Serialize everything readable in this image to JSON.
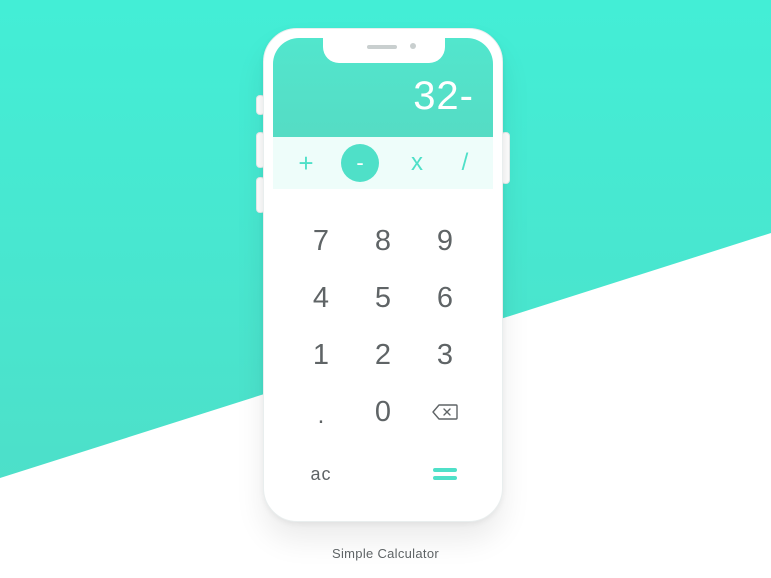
{
  "display": {
    "value": "32-"
  },
  "operators": {
    "plus": "+",
    "minus": "-",
    "times": "x",
    "divide": "/",
    "active": "minus"
  },
  "keypad": {
    "row1": [
      "7",
      "8",
      "9"
    ],
    "row2": [
      "4",
      "5",
      "6"
    ],
    "row3": [
      "1",
      "2",
      "3"
    ],
    "row4": [
      ".",
      "0"
    ],
    "backspace_icon": "backspace-icon",
    "clear_label": "ac",
    "equals_icon": "equals-icon"
  },
  "caption": "Simple Calculator",
  "colors": {
    "accent": "#4fe0c8",
    "background_teal": "#43eed6",
    "key_text": "#5f6466",
    "operator_row_bg": "#eefdfa"
  }
}
